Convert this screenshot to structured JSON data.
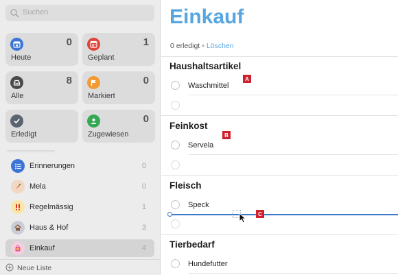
{
  "sidebar": {
    "search_placeholder": "Suchen",
    "smart_lists": [
      {
        "label": "Heute",
        "count": "0",
        "color": "#3c75d6",
        "icon": "calendar-today-icon"
      },
      {
        "label": "Geplant",
        "count": "1",
        "color": "#e0443b",
        "icon": "calendar-grid-icon"
      },
      {
        "label": "Alle",
        "count": "8",
        "color": "#4a4a4a",
        "icon": "tray-icon"
      },
      {
        "label": "Markiert",
        "count": "0",
        "color": "#f39b33",
        "icon": "flag-icon"
      },
      {
        "label": "Erledigt",
        "count": "",
        "color": "#5a6470",
        "icon": "checkmark-icon"
      },
      {
        "label": "Zugewiesen",
        "count": "0",
        "color": "#34a853",
        "icon": "person-icon"
      }
    ],
    "lists": [
      {
        "name": "Erinnerungen",
        "count": "0",
        "color": "#3c75d6",
        "icon": "bullet-list-icon",
        "selected": false
      },
      {
        "name": "Mela",
        "count": "0",
        "color": "#f2d7c2",
        "icon": "carrot-icon",
        "selected": false
      },
      {
        "name": "Regelmässig",
        "count": "1",
        "color": "#fbe6a5",
        "icon": "double-exclamation-icon",
        "selected": false
      },
      {
        "name": "Haus & Hof",
        "count": "3",
        "color": "#c9ced6",
        "icon": "house-icon",
        "selected": false
      },
      {
        "name": "Einkauf",
        "count": "4",
        "color": "#f3cfe0",
        "icon": "shopping-bag-icon",
        "selected": true
      }
    ],
    "new_list_label": "Neue Liste"
  },
  "main": {
    "title": "Einkauf",
    "done_text": "0 erledigt",
    "separator": "•",
    "clear_label": "Löschen",
    "sections": [
      {
        "title": "Haushaltsartikel",
        "items": [
          "Waschmittel"
        ],
        "badge": "A"
      },
      {
        "title": "Feinkost",
        "items": [
          "Servela"
        ],
        "badge": "B"
      },
      {
        "title": "Fleisch",
        "items": [
          "Speck"
        ],
        "badge": "C"
      },
      {
        "title": "Tierbedarf",
        "items": [
          "Hundefutter"
        ]
      }
    ]
  },
  "colors": {
    "accent": "#57a6e0",
    "badge": "#d01f2d",
    "drag_line": "#3f7ac4"
  }
}
